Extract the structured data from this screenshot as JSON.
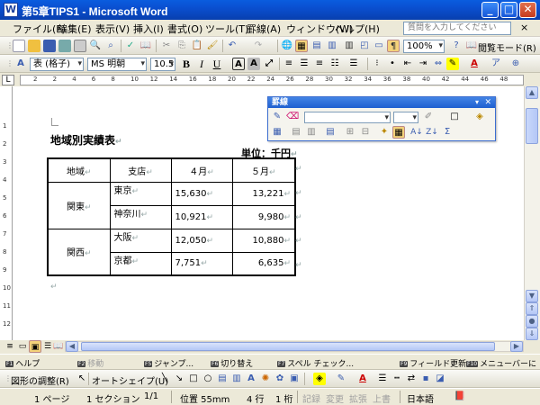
{
  "window": {
    "title": "第5章TIPS1 - Microsoft Word",
    "app_icon": "W",
    "min": "_",
    "max": "□",
    "close": "✕"
  },
  "menu": {
    "items": [
      "ファイル(F)",
      "編集(E)",
      "表示(V)",
      "挿入(I)",
      "書式(O)",
      "ツール(T)",
      "罫線(A)",
      "ウィンドウ(W)",
      "ヘルプ(H)"
    ],
    "help_placeholder": "質問を入力してください",
    "help_close": "×"
  },
  "toolbar1": {
    "zoom": "100%",
    "reading_mode": "閲覧モード(R)"
  },
  "toolbar2": {
    "style": "表 (格子)",
    "font": "MS 明朝",
    "size": "10.5",
    "bold": "B",
    "italic": "I",
    "underline": "U"
  },
  "ruler": {
    "h_numbers": [
      "2",
      "2",
      "4",
      "6",
      "8",
      "10",
      "12",
      "14",
      "16",
      "18",
      "20",
      "22",
      "24",
      "26",
      "28",
      "30",
      "32",
      "34",
      "36",
      "38",
      "40",
      "42",
      "44",
      "46",
      "48"
    ],
    "v_numbers": [
      "1",
      "2",
      "3",
      "4",
      "5",
      "6",
      "7",
      "8",
      "9",
      "10",
      "11",
      "12"
    ]
  },
  "borders_panel": {
    "title": "罫線",
    "close": "✕",
    "menu_arrow": "▾"
  },
  "document": {
    "title": "地域別実績表",
    "unit": "単位：千円",
    "para_mark": "↵",
    "header": [
      "地域",
      "支店",
      "４月",
      "５月"
    ],
    "groups": [
      {
        "region": "関東",
        "rows": [
          {
            "branch": "東京",
            "apr": "15,630",
            "may": "13,221"
          },
          {
            "branch": "神奈川",
            "apr": "10,921",
            "may": "9,980"
          }
        ]
      },
      {
        "region": "関西",
        "rows": [
          {
            "branch": "大阪",
            "apr": "12,050",
            "may": "10,880"
          },
          {
            "branch": "京都",
            "apr": "7,751",
            "may": "6,635"
          }
        ]
      }
    ]
  },
  "fkeys": [
    {
      "num": "F1",
      "label": "ヘルプ",
      "enabled": true
    },
    {
      "num": "F2",
      "label": "移動",
      "enabled": false
    },
    {
      "num": "F5",
      "label": "ジャンプ...",
      "enabled": true
    },
    {
      "num": "F6",
      "label": "切り替え",
      "enabled": true
    },
    {
      "num": "F7",
      "label": "スペル チェック...",
      "enabled": true
    },
    {
      "num": "F9",
      "label": "フィールド更新",
      "enabled": true
    },
    {
      "num": "F10",
      "label": "メニューバーに",
      "enabled": true
    }
  ],
  "drawbar": {
    "draw": "図形の調整(R)",
    "autoshape": "オートシェイプ(U)"
  },
  "status": {
    "page": "1 ページ",
    "section": "1 セクション",
    "pages": "1/1",
    "position": "位置 55mm",
    "line": "4 行",
    "col": "1 桁",
    "rec": "記録",
    "trk": "変更",
    "ext": "拡張",
    "ovr": "上書",
    "lang": "日本語"
  }
}
